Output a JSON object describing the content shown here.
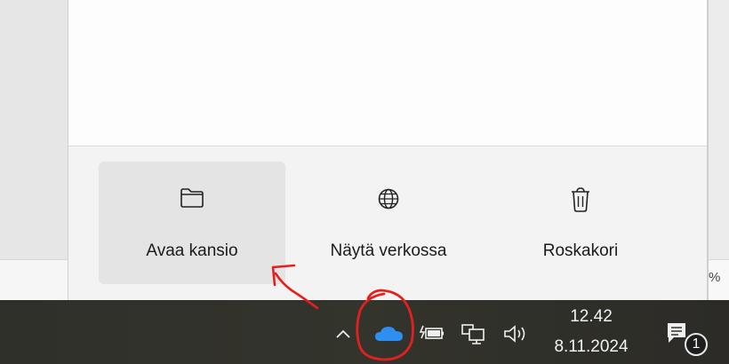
{
  "onedrive_panel": {
    "actions": [
      {
        "label": "Avaa kansio",
        "icon": "folder-icon"
      },
      {
        "label": "Näytä verkossa",
        "icon": "globe-icon"
      },
      {
        "label": "Roskakori",
        "icon": "trash-icon"
      }
    ]
  },
  "background": {
    "partial_text": "%"
  },
  "taskbar": {
    "tray_icons": [
      "chevron-up-icon",
      "onedrive-cloud-icon",
      "battery-icon",
      "network-icon",
      "volume-icon"
    ],
    "time": "12.42",
    "date": "8.11.2024",
    "notification_count": "1"
  },
  "colors": {
    "annotation": "#e32020",
    "onedrive_blue": "#2f8ff0",
    "taskbar": "#31322b",
    "hover_bg": "#e4e4e4"
  }
}
